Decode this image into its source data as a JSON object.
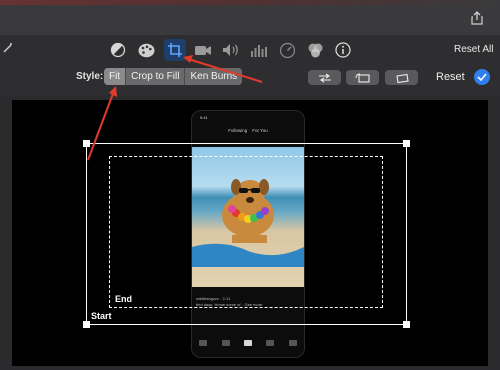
{
  "toolbar": {
    "reset_all_label": "Reset All",
    "icons": [
      "color-balance-icon",
      "color-palette-icon",
      "crop-icon",
      "stabilization-camera-icon",
      "volume-icon",
      "equalizer-icon",
      "speed-icon",
      "noise-reduction-icon",
      "info-icon"
    ],
    "selected_icon": "crop-icon"
  },
  "style_bar": {
    "label": "Style:",
    "options": [
      "Fit",
      "Crop to Fill",
      "Ken Burns"
    ],
    "selected": "Fit",
    "reset_label": "Reset"
  },
  "preview": {
    "start_label": "Start",
    "end_label": "End",
    "phone": {
      "status_time": "9:41",
      "tab_following": "Following",
      "tab_for_you": "For You",
      "username": "wildthangzzz · 2-11",
      "caption": "bird days. Home some of ...See more"
    }
  },
  "colors": {
    "accent": "#2f7ff0",
    "annotation_arrow": "#e23a2b",
    "toolbar_bg": "#2e2e30"
  }
}
